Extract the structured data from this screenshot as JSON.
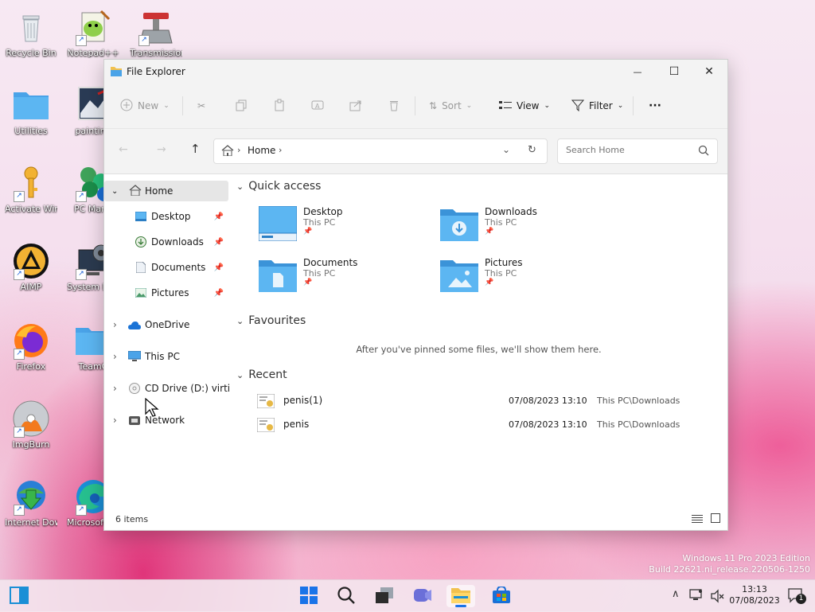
{
  "desktop": {
    "icons": [
      {
        "label": "Recycle Bin"
      },
      {
        "label": "Notepad++"
      },
      {
        "label": "Transmission"
      },
      {
        "label": "Utilities"
      },
      {
        "label": "painting"
      },
      {
        "label": "Activate Windows"
      },
      {
        "label": "PC Mana"
      },
      {
        "label": "AIMP"
      },
      {
        "label": "System Inform"
      },
      {
        "label": "Firefox"
      },
      {
        "label": "TeamC"
      },
      {
        "label": "ImgBurn"
      },
      {
        "label": "Internet Downlo..."
      },
      {
        "label": "Microsoft Edge"
      }
    ]
  },
  "window": {
    "title": "File Explorer",
    "controls": {
      "minimize": "—",
      "maximize": "☐",
      "close": "✕"
    },
    "toolbar": {
      "new_label": "New",
      "sort_label": "Sort",
      "view_label": "View",
      "filter_label": "Filter",
      "more_label": "···"
    },
    "address": {
      "home_label": "Home"
    },
    "search": {
      "placeholder": "Search Home"
    },
    "nav": {
      "home": "Home",
      "pinned": [
        "Desktop",
        "Downloads",
        "Documents",
        "Pictures"
      ],
      "onedrive": "OneDrive",
      "thispc": "This PC",
      "cddrive": "CD Drive (D:) virtio-w",
      "network": "Network"
    },
    "content": {
      "quick_access_title": "Quick access",
      "quick_access": [
        {
          "name": "Desktop",
          "location": "This PC"
        },
        {
          "name": "Downloads",
          "location": "This PC"
        },
        {
          "name": "Documents",
          "location": "This PC"
        },
        {
          "name": "Pictures",
          "location": "This PC"
        }
      ],
      "favourites_title": "Favourites",
      "favourites_empty": "After you've pinned some files, we'll show them here.",
      "recent_title": "Recent",
      "recent": [
        {
          "name": "penis(1)",
          "date": "07/08/2023 13:10",
          "location": "This PC\\Downloads"
        },
        {
          "name": "penis",
          "date": "07/08/2023 13:10",
          "location": "This PC\\Downloads"
        }
      ]
    },
    "status": {
      "items": "6 items"
    }
  },
  "watermark": {
    "line1": "Windows 11 Pro 2023 Edition",
    "line2": "Build 22621.ni_release.220506-1250"
  },
  "taskbar": {
    "time": "13:13",
    "date": "07/08/2023",
    "notification_count": "1"
  }
}
